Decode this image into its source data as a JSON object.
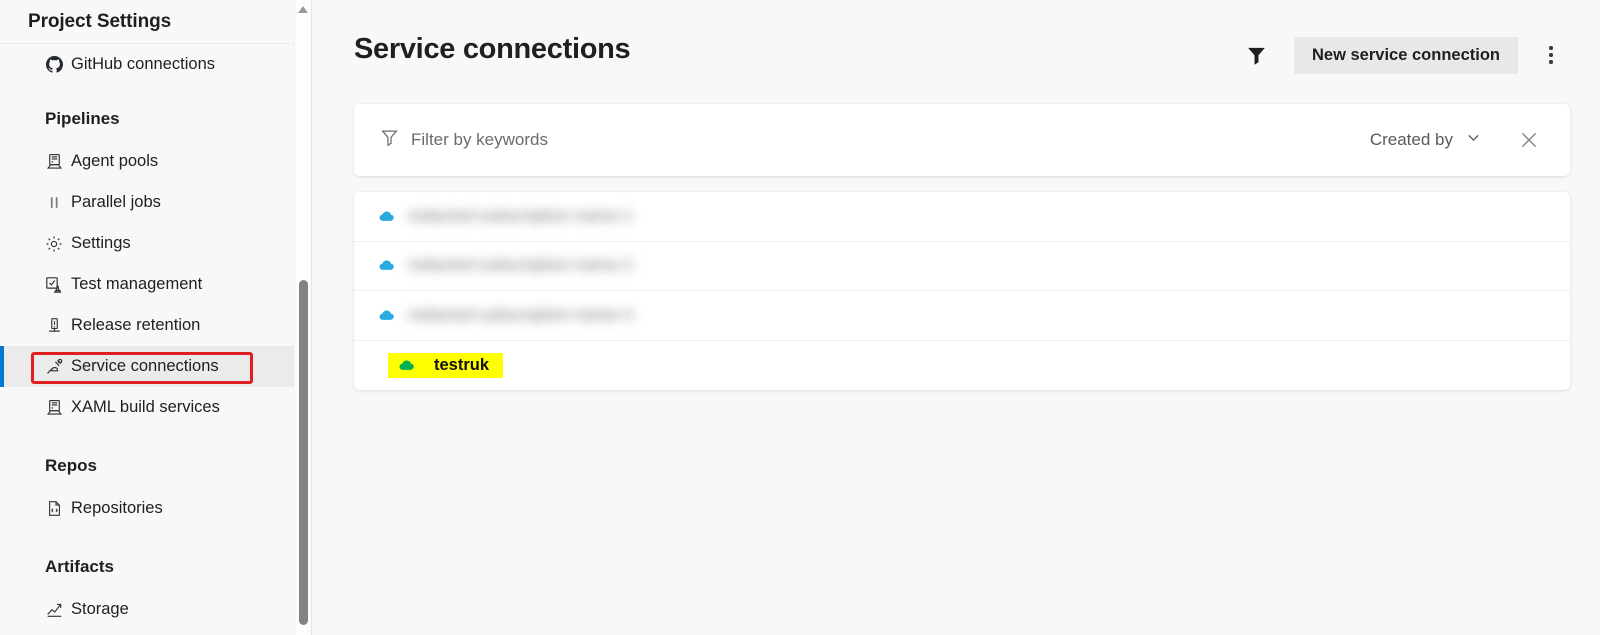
{
  "sidebar": {
    "title": "Project Settings",
    "scroll": {
      "thumb_present": true,
      "arrow_icon": "chevron-up-icon"
    },
    "entries": [
      {
        "kind": "item",
        "label": "GitHub connections",
        "icon": "github-icon",
        "selected": false
      },
      {
        "kind": "group",
        "label": "Pipelines"
      },
      {
        "kind": "item",
        "label": "Agent pools",
        "icon": "server-icon",
        "selected": false
      },
      {
        "kind": "item",
        "label": "Parallel jobs",
        "icon": "parallel-bars-icon",
        "selected": false
      },
      {
        "kind": "item",
        "label": "Settings",
        "icon": "gear-icon",
        "selected": false
      },
      {
        "kind": "item",
        "label": "Test management",
        "icon": "test-beaker-icon",
        "selected": false
      },
      {
        "kind": "item",
        "label": "Release retention",
        "icon": "retention-icon",
        "selected": false
      },
      {
        "kind": "item",
        "label": "Service connections",
        "icon": "plug-icon",
        "selected": true
      },
      {
        "kind": "item",
        "label": "XAML build services",
        "icon": "server-icon",
        "selected": false
      },
      {
        "kind": "group",
        "label": "Repos"
      },
      {
        "kind": "item",
        "label": "Repositories",
        "icon": "file-code-icon",
        "selected": false
      },
      {
        "kind": "group",
        "label": "Artifacts"
      },
      {
        "kind": "item",
        "label": "Storage",
        "icon": "chart-up-icon",
        "selected": false
      }
    ]
  },
  "header": {
    "title": "Service connections",
    "filter_icon": "funnel-filter-icon",
    "new_connection_label": "New service connection",
    "more_actions_icon": "kebab-menu-icon"
  },
  "filter_bar": {
    "keyword_icon": "funnel-icon",
    "keyword_placeholder": "Filter by keywords",
    "keyword_value": "",
    "created_by_label": "Created by",
    "created_by_chevron": "chevron-down-icon",
    "clear_icon": "close-icon"
  },
  "connections": [
    {
      "name": "redacted-subscription-name-1",
      "icon": "cloud-icon",
      "icon_color": "#29ABE2",
      "blurred": true,
      "highlighted": false
    },
    {
      "name": "redacted-subscription-name-2",
      "icon": "cloud-icon",
      "icon_color": "#29ABE2",
      "blurred": true,
      "highlighted": false
    },
    {
      "name": "redacted-subscription-name-3",
      "icon": "cloud-icon",
      "icon_color": "#29ABE2",
      "blurred": true,
      "highlighted": false
    },
    {
      "name": "testruk",
      "icon": "cloud-icon",
      "icon_color": "#00B050",
      "blurred": false,
      "highlighted": true
    }
  ],
  "annotations": {
    "highlight_color": "#ffff00",
    "rect_color": "#e02020",
    "accent_color": "#0078d4",
    "rect_target": "Service connections"
  }
}
